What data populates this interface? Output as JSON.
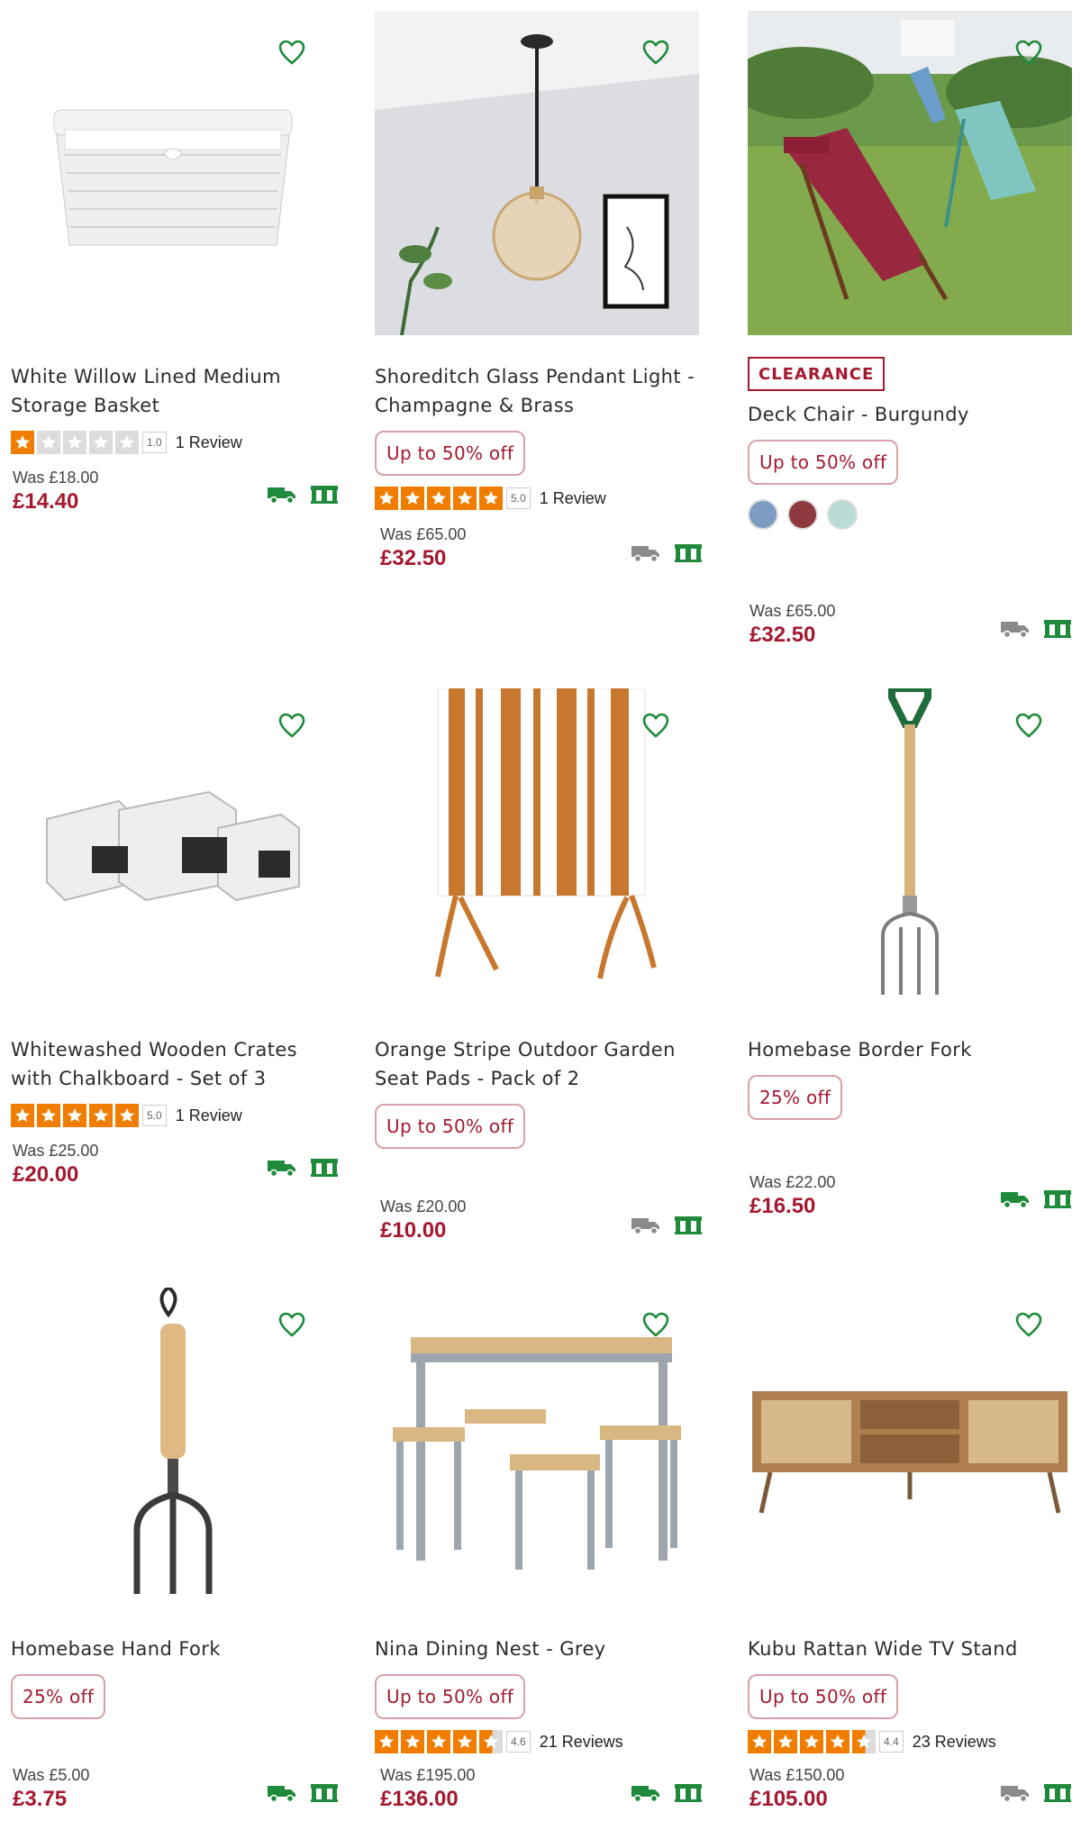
{
  "products": [
    {
      "title": "White Willow Lined Medium Storage Basket",
      "badge": "",
      "rating": {
        "score": "1.0",
        "stars": 1,
        "reviews": "1 Review"
      },
      "was": "Was £18.00",
      "price": "£14.40",
      "delivery_available": true,
      "collect_available": true
    },
    {
      "title": "Shoreditch Glass Pendant Light - Champagne & Brass",
      "badge": "Up to 50% off",
      "rating": {
        "score": "5.0",
        "stars": 5,
        "reviews": "1 Review"
      },
      "was": "Was £65.00",
      "price": "£32.50",
      "delivery_available": false,
      "collect_available": true
    },
    {
      "clearance": "CLEARANCE",
      "title": "Deck Chair - Burgundy",
      "badge": "Up to 50% off",
      "swatches": [
        "#7e9cc2",
        "#8e3a3e",
        "#b9ddd6"
      ],
      "was": "Was £65.00",
      "price": "£32.50",
      "delivery_available": false,
      "collect_available": true
    },
    {
      "title": "Whitewashed Wooden Crates with Chalkboard - Set of 3",
      "badge": "",
      "rating": {
        "score": "5.0",
        "stars": 5,
        "reviews": "1 Review"
      },
      "was": "Was £25.00",
      "price": "£20.00",
      "delivery_available": true,
      "collect_available": true
    },
    {
      "title": "Orange Stripe Outdoor Garden Seat Pads - Pack of 2",
      "badge": "Up to 50% off",
      "was": "Was £20.00",
      "price": "£10.00",
      "delivery_available": false,
      "collect_available": true
    },
    {
      "title": "Homebase Border Fork",
      "badge": "25% off",
      "was": "Was £22.00",
      "price": "£16.50",
      "delivery_available": true,
      "collect_available": true
    },
    {
      "title": "Homebase Hand Fork",
      "badge": "25% off",
      "was": "Was £5.00",
      "price": "£3.75",
      "delivery_available": true,
      "collect_available": true
    },
    {
      "title": "Nina Dining Nest - Grey",
      "badge": "Up to 50% off",
      "rating": {
        "score": "4.6",
        "stars": 4.5,
        "reviews": "21 Reviews"
      },
      "was": "Was £195.00",
      "price": "£136.00",
      "delivery_available": true,
      "collect_available": true
    },
    {
      "title": "Kubu Rattan Wide TV Stand",
      "badge": "Up to 50% off",
      "rating": {
        "score": "4.4",
        "stars": 4.5,
        "reviews": "23 Reviews"
      },
      "was": "Was £150.00",
      "price": "£105.00",
      "delivery_available": false,
      "collect_available": true
    }
  ],
  "colors": {
    "price": "#a3192f",
    "badge_border": "#d8a0a7",
    "star": "#f07d00",
    "wishlist": "#1f8a3c",
    "delivery_on": "#1f8a3c",
    "delivery_off": "#8a8a8a"
  }
}
